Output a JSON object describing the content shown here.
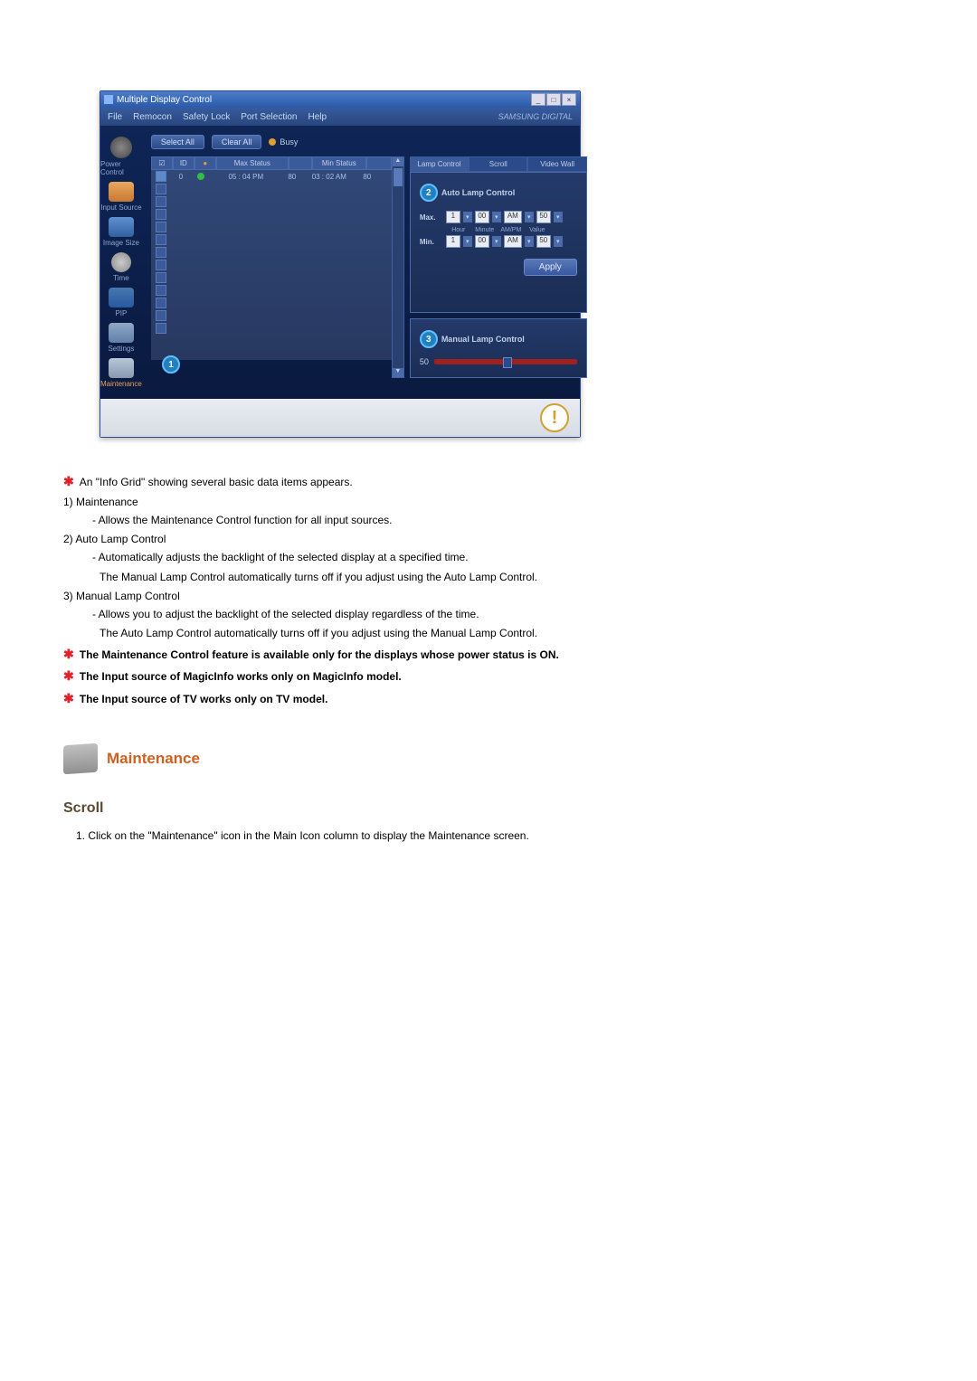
{
  "window": {
    "title": "Multiple Display Control",
    "menu": [
      "File",
      "Remocon",
      "Safety Lock",
      "Port Selection",
      "Help"
    ],
    "logo": "SAMSUNG DIGITAL"
  },
  "sidebar": {
    "items": [
      {
        "label": "Power Control"
      },
      {
        "label": "Input Source"
      },
      {
        "label": "Image Size"
      },
      {
        "label": "Time"
      },
      {
        "label": "PIP"
      },
      {
        "label": "Settings"
      },
      {
        "label": "Maintenance"
      }
    ]
  },
  "toolbar": {
    "select_all": "Select All",
    "clear_all": "Clear All",
    "busy": "Busy"
  },
  "grid": {
    "headers": {
      "check": "☑",
      "id": "ID",
      "status": "●",
      "max": "Max Status",
      "min": "Min Status"
    },
    "rows": [
      {
        "checked": true,
        "id": "0",
        "stColor": "#30c040",
        "max": "05 : 04 PM",
        "maxv": "80",
        "min": "03 : 02 AM",
        "minv": "80"
      }
    ],
    "blank_count": 12
  },
  "tabs": {
    "t1": "Lamp Control",
    "t2": "Scroll",
    "t3": "Video Wall"
  },
  "auto_lamp": {
    "title": "Auto Lamp Control",
    "sublabels": {
      "hour": "Hour",
      "minute": "Minute",
      "ampm": "AM/PM",
      "value": "Value"
    },
    "max": {
      "label": "Max.",
      "hour": "1",
      "minute": "00",
      "ampm": "AM",
      "value": "50"
    },
    "min": {
      "label": "Min.",
      "hour": "1",
      "minute": "00",
      "ampm": "AM",
      "value": "50"
    },
    "apply": "Apply"
  },
  "manual_lamp": {
    "title": "Manual Lamp Control",
    "value": "50"
  },
  "annotations": {
    "a1": "1",
    "a2": "2",
    "a3": "3"
  },
  "doc": {
    "star1": "An \"Info Grid\" showing several basic data items appears.",
    "item1_t": "1)  Maintenance",
    "item1_s": "- Allows the Maintenance Control function for all input sources.",
    "item2_t": "2)  Auto Lamp Control",
    "item2_s1": "- Automatically adjusts the backlight of the selected display at a specified time.",
    "item2_s2": "The Manual Lamp Control automatically turns off if you adjust using the Auto Lamp Control.",
    "item3_t": "3)  Manual Lamp Control",
    "item3_s1": "- Allows you to adjust the backlight of the selected display regardless of the time.",
    "item3_s2": "The Auto Lamp Control automatically turns off if you adjust using the Manual Lamp Control.",
    "star2": "The Maintenance Control feature is available only for the displays whose power status is ON.",
    "star3": "The Input source of MagicInfo works only on MagicInfo model.",
    "star4": "The Input source of TV works only on TV model.",
    "section": "Maintenance",
    "subhead": "Scroll",
    "ol1": "1.  Click on the \"Maintenance\" icon in the Main Icon column to display the Maintenance screen."
  }
}
